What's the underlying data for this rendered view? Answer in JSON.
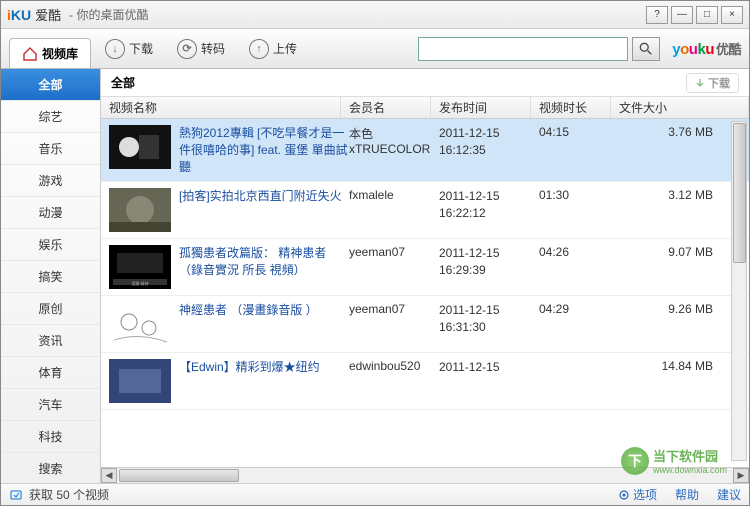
{
  "title": {
    "brand_i": "i",
    "brand_ku": "KU",
    "brand_cn": "爱酷",
    "subtitle": "- 你的桌面优酷"
  },
  "winbtns": {
    "help": "?",
    "min": "—",
    "max": "□",
    "close": "×"
  },
  "toolbar": {
    "video_lib": "视频库",
    "download": "下载",
    "transcode": "转码",
    "upload": "上传",
    "search_placeholder": "",
    "youku_cn": "优酷"
  },
  "sidebar": {
    "items": [
      {
        "label": "全部",
        "active": true
      },
      {
        "label": "综艺"
      },
      {
        "label": "音乐"
      },
      {
        "label": "游戏"
      },
      {
        "label": "动漫"
      },
      {
        "label": "娱乐"
      },
      {
        "label": "搞笑"
      },
      {
        "label": "原创"
      },
      {
        "label": "资讯"
      },
      {
        "label": "体育"
      },
      {
        "label": "汽车"
      },
      {
        "label": "科技"
      },
      {
        "label": "搜索"
      }
    ]
  },
  "content": {
    "header": "全部",
    "download_btn": "下载",
    "cols": {
      "name": "视频名称",
      "member": "会员名",
      "time": "发布时间",
      "dur": "视频时长",
      "size": "文件大小"
    },
    "rows": [
      {
        "title": "熱狗2012專輯 [不吃早餐才是一件很嘻哈的事] feat. 蛋堡  單曲試聽",
        "member": "本色xTRUECOLOR",
        "time": "2011-12-15 16:12:35",
        "dur": "04:15",
        "size": "3.76 MB",
        "sel": true
      },
      {
        "title": "[拍客]实拍北京西直门附近失火",
        "member": "fxmalele",
        "time": "2011-12-15 16:22:12",
        "dur": "01:30",
        "size": "3.12 MB"
      },
      {
        "title": "孤獨患者改篇版： 精神患者 （錄音實況  所長 視頻）",
        "member": "yeeman07",
        "time": "2011-12-15 16:29:39",
        "dur": "04:26",
        "size": "9.07 MB"
      },
      {
        "title": "神經患者 （漫畫錄音版 ）",
        "member": "yeeman07",
        "time": "2011-12-15 16:31:30",
        "dur": "04:29",
        "size": "9.26 MB"
      },
      {
        "title": "【Edwin】精彩到爆★纽约",
        "member": "edwinbou520",
        "time": "2011-12-15",
        "dur": "",
        "size": "14.84 MB"
      }
    ]
  },
  "status": {
    "text": "获取 50 个视频",
    "options": "选项",
    "help": "帮助",
    "suggest": "建议"
  },
  "watermark": {
    "text": "当下软件园",
    "url": "www.downxia.com"
  }
}
